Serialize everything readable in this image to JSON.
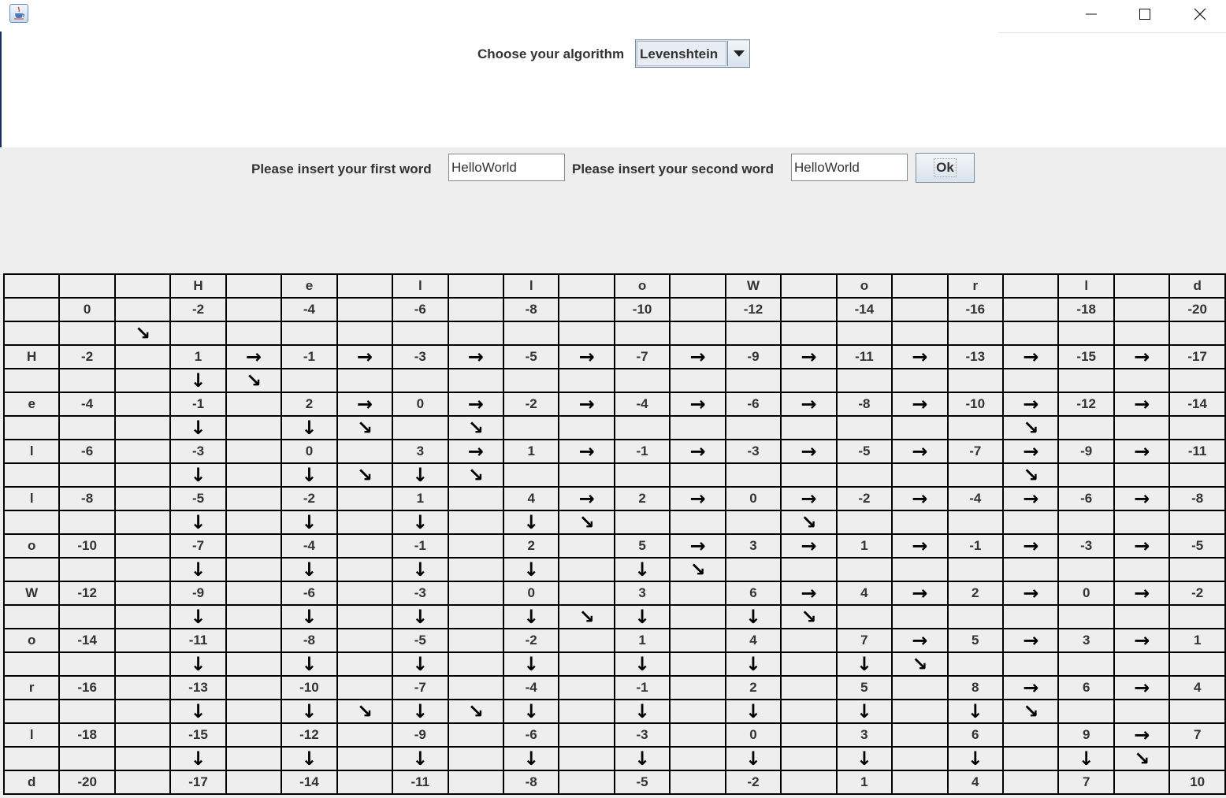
{
  "window": {
    "app_icon": "java-cup-icon",
    "controls": {
      "minimize": "minimize-icon",
      "maximize": "maximize-icon",
      "close": "close-icon"
    }
  },
  "algorithm": {
    "label": "Choose your algorithm",
    "selected": "Levenshtein",
    "dropdown_icon": "triangle-down-icon"
  },
  "words": {
    "first_label": "Please insert your first word",
    "first_value": "HelloWorld",
    "second_label": "Please insert your second word",
    "second_value": "HelloWorld",
    "ok_label": "Ok"
  },
  "grid": {
    "rows": [
      [
        "",
        "",
        "",
        "H",
        "",
        "e",
        "",
        "l",
        "",
        "l",
        "",
        "o",
        "",
        "W",
        "",
        "o",
        "",
        "r",
        "",
        "l",
        "",
        "d"
      ],
      [
        "",
        "0",
        "",
        "-2",
        "",
        "-4",
        "",
        "-6",
        "",
        "-8",
        "",
        "-10",
        "",
        "-12",
        "",
        "-14",
        "",
        "-16",
        "",
        "-18",
        "",
        "-20"
      ],
      [
        "",
        "",
        "↘",
        "",
        "",
        "",
        "",
        "",
        "",
        "",
        "",
        "",
        "",
        "",
        "",
        "",
        "",
        "",
        "",
        "",
        "",
        ""
      ],
      [
        "H",
        "-2",
        "",
        "1",
        "→",
        "-1",
        "→",
        "-3",
        "→",
        "-5",
        "→",
        "-7",
        "→",
        "-9",
        "→",
        "-11",
        "→",
        "-13",
        "→",
        "-15",
        "→",
        "-17"
      ],
      [
        "",
        "",
        "",
        "↓",
        "↘",
        "",
        "",
        "",
        "",
        "",
        "",
        "",
        "",
        "",
        "",
        "",
        "",
        "",
        "",
        "",
        "",
        ""
      ],
      [
        "e",
        "-4",
        "",
        "-1",
        "",
        "2",
        "→",
        "0",
        "→",
        "-2",
        "→",
        "-4",
        "→",
        "-6",
        "→",
        "-8",
        "→",
        "-10",
        "→",
        "-12",
        "→",
        "-14"
      ],
      [
        "",
        "",
        "",
        "↓",
        "",
        "↓",
        "↘",
        "",
        "↘",
        "",
        "",
        "",
        "",
        "",
        "",
        "",
        "",
        "",
        "↘",
        "",
        "",
        ""
      ],
      [
        "l",
        "-6",
        "",
        "-3",
        "",
        "0",
        "",
        "3",
        "→",
        "1",
        "→",
        "-1",
        "→",
        "-3",
        "→",
        "-5",
        "→",
        "-7",
        "→",
        "-9",
        "→",
        "-11"
      ],
      [
        "",
        "",
        "",
        "↓",
        "",
        "↓",
        "↘",
        "↓",
        "↘",
        "",
        "",
        "",
        "",
        "",
        "",
        "",
        "",
        "",
        "↘",
        "",
        "",
        ""
      ],
      [
        "l",
        "-8",
        "",
        "-5",
        "",
        "-2",
        "",
        "1",
        "",
        "4",
        "→",
        "2",
        "→",
        "0",
        "→",
        "-2",
        "→",
        "-4",
        "→",
        "-6",
        "→",
        "-8"
      ],
      [
        "",
        "",
        "",
        "↓",
        "",
        "↓",
        "",
        "↓",
        "",
        "↓",
        "↘",
        "",
        "",
        "",
        "↘",
        "",
        "",
        "",
        "",
        "",
        "",
        ""
      ],
      [
        "o",
        "-10",
        "",
        "-7",
        "",
        "-4",
        "",
        "-1",
        "",
        "2",
        "",
        "5",
        "→",
        "3",
        "→",
        "1",
        "→",
        "-1",
        "→",
        "-3",
        "→",
        "-5"
      ],
      [
        "",
        "",
        "",
        "↓",
        "",
        "↓",
        "",
        "↓",
        "",
        "↓",
        "",
        "↓",
        "↘",
        "",
        "",
        "",
        "",
        "",
        "",
        "",
        "",
        ""
      ],
      [
        "W",
        "-12",
        "",
        "-9",
        "",
        "-6",
        "",
        "-3",
        "",
        "0",
        "",
        "3",
        "",
        "6",
        "→",
        "4",
        "→",
        "2",
        "→",
        "0",
        "→",
        "-2"
      ],
      [
        "",
        "",
        "",
        "↓",
        "",
        "↓",
        "",
        "↓",
        "",
        "↓",
        "↘",
        "↓",
        "",
        "↓",
        "↘",
        "",
        "",
        "",
        "",
        "",
        "",
        ""
      ],
      [
        "o",
        "-14",
        "",
        "-11",
        "",
        "-8",
        "",
        "-5",
        "",
        "-2",
        "",
        "1",
        "",
        "4",
        "",
        "7",
        "→",
        "5",
        "→",
        "3",
        "→",
        "1"
      ],
      [
        "",
        "",
        "",
        "↓",
        "",
        "↓",
        "",
        "↓",
        "",
        "↓",
        "",
        "↓",
        "",
        "↓",
        "",
        "↓",
        "↘",
        "",
        "",
        "",
        "",
        ""
      ],
      [
        "r",
        "-16",
        "",
        "-13",
        "",
        "-10",
        "",
        "-7",
        "",
        "-4",
        "",
        "-1",
        "",
        "2",
        "",
        "5",
        "",
        "8",
        "→",
        "6",
        "→",
        "4"
      ],
      [
        "",
        "",
        "",
        "↓",
        "",
        "↓",
        "↘",
        "↓",
        "↘",
        "↓",
        "",
        "↓",
        "",
        "↓",
        "",
        "↓",
        "",
        "↓",
        "↘",
        "",
        "",
        ""
      ],
      [
        "l",
        "-18",
        "",
        "-15",
        "",
        "-12",
        "",
        "-9",
        "",
        "-6",
        "",
        "-3",
        "",
        "0",
        "",
        "3",
        "",
        "6",
        "",
        "9",
        "→",
        "7"
      ],
      [
        "",
        "",
        "",
        "↓",
        "",
        "↓",
        "",
        "↓",
        "",
        "↓",
        "",
        "↓",
        "",
        "↓",
        "",
        "↓",
        "",
        "↓",
        "",
        "↓",
        "↘",
        ""
      ],
      [
        "d",
        "-20",
        "",
        "-17",
        "",
        "-14",
        "",
        "-11",
        "",
        "-8",
        "",
        "-5",
        "",
        "-2",
        "",
        "1",
        "",
        "4",
        "",
        "7",
        "",
        "10"
      ]
    ]
  }
}
